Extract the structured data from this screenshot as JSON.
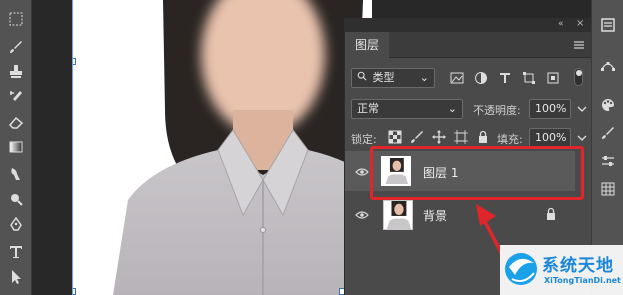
{
  "panel": {
    "tab_label": "图层",
    "filter_label": "类型",
    "blend_mode": "正常",
    "opacity_label": "不透明度:",
    "opacity_value": "100%",
    "lock_label": "锁定:",
    "fill_label": "填充:",
    "fill_value": "100%"
  },
  "layers": [
    {
      "name": "图层 1",
      "selected": true
    },
    {
      "name": "背景",
      "locked": true
    }
  ],
  "watermark": {
    "title": "系统天地",
    "url": "XiTongTianDi.net"
  },
  "colors": {
    "highlight_box": "#e0262b",
    "accent_blue": "#1aa1e8"
  }
}
